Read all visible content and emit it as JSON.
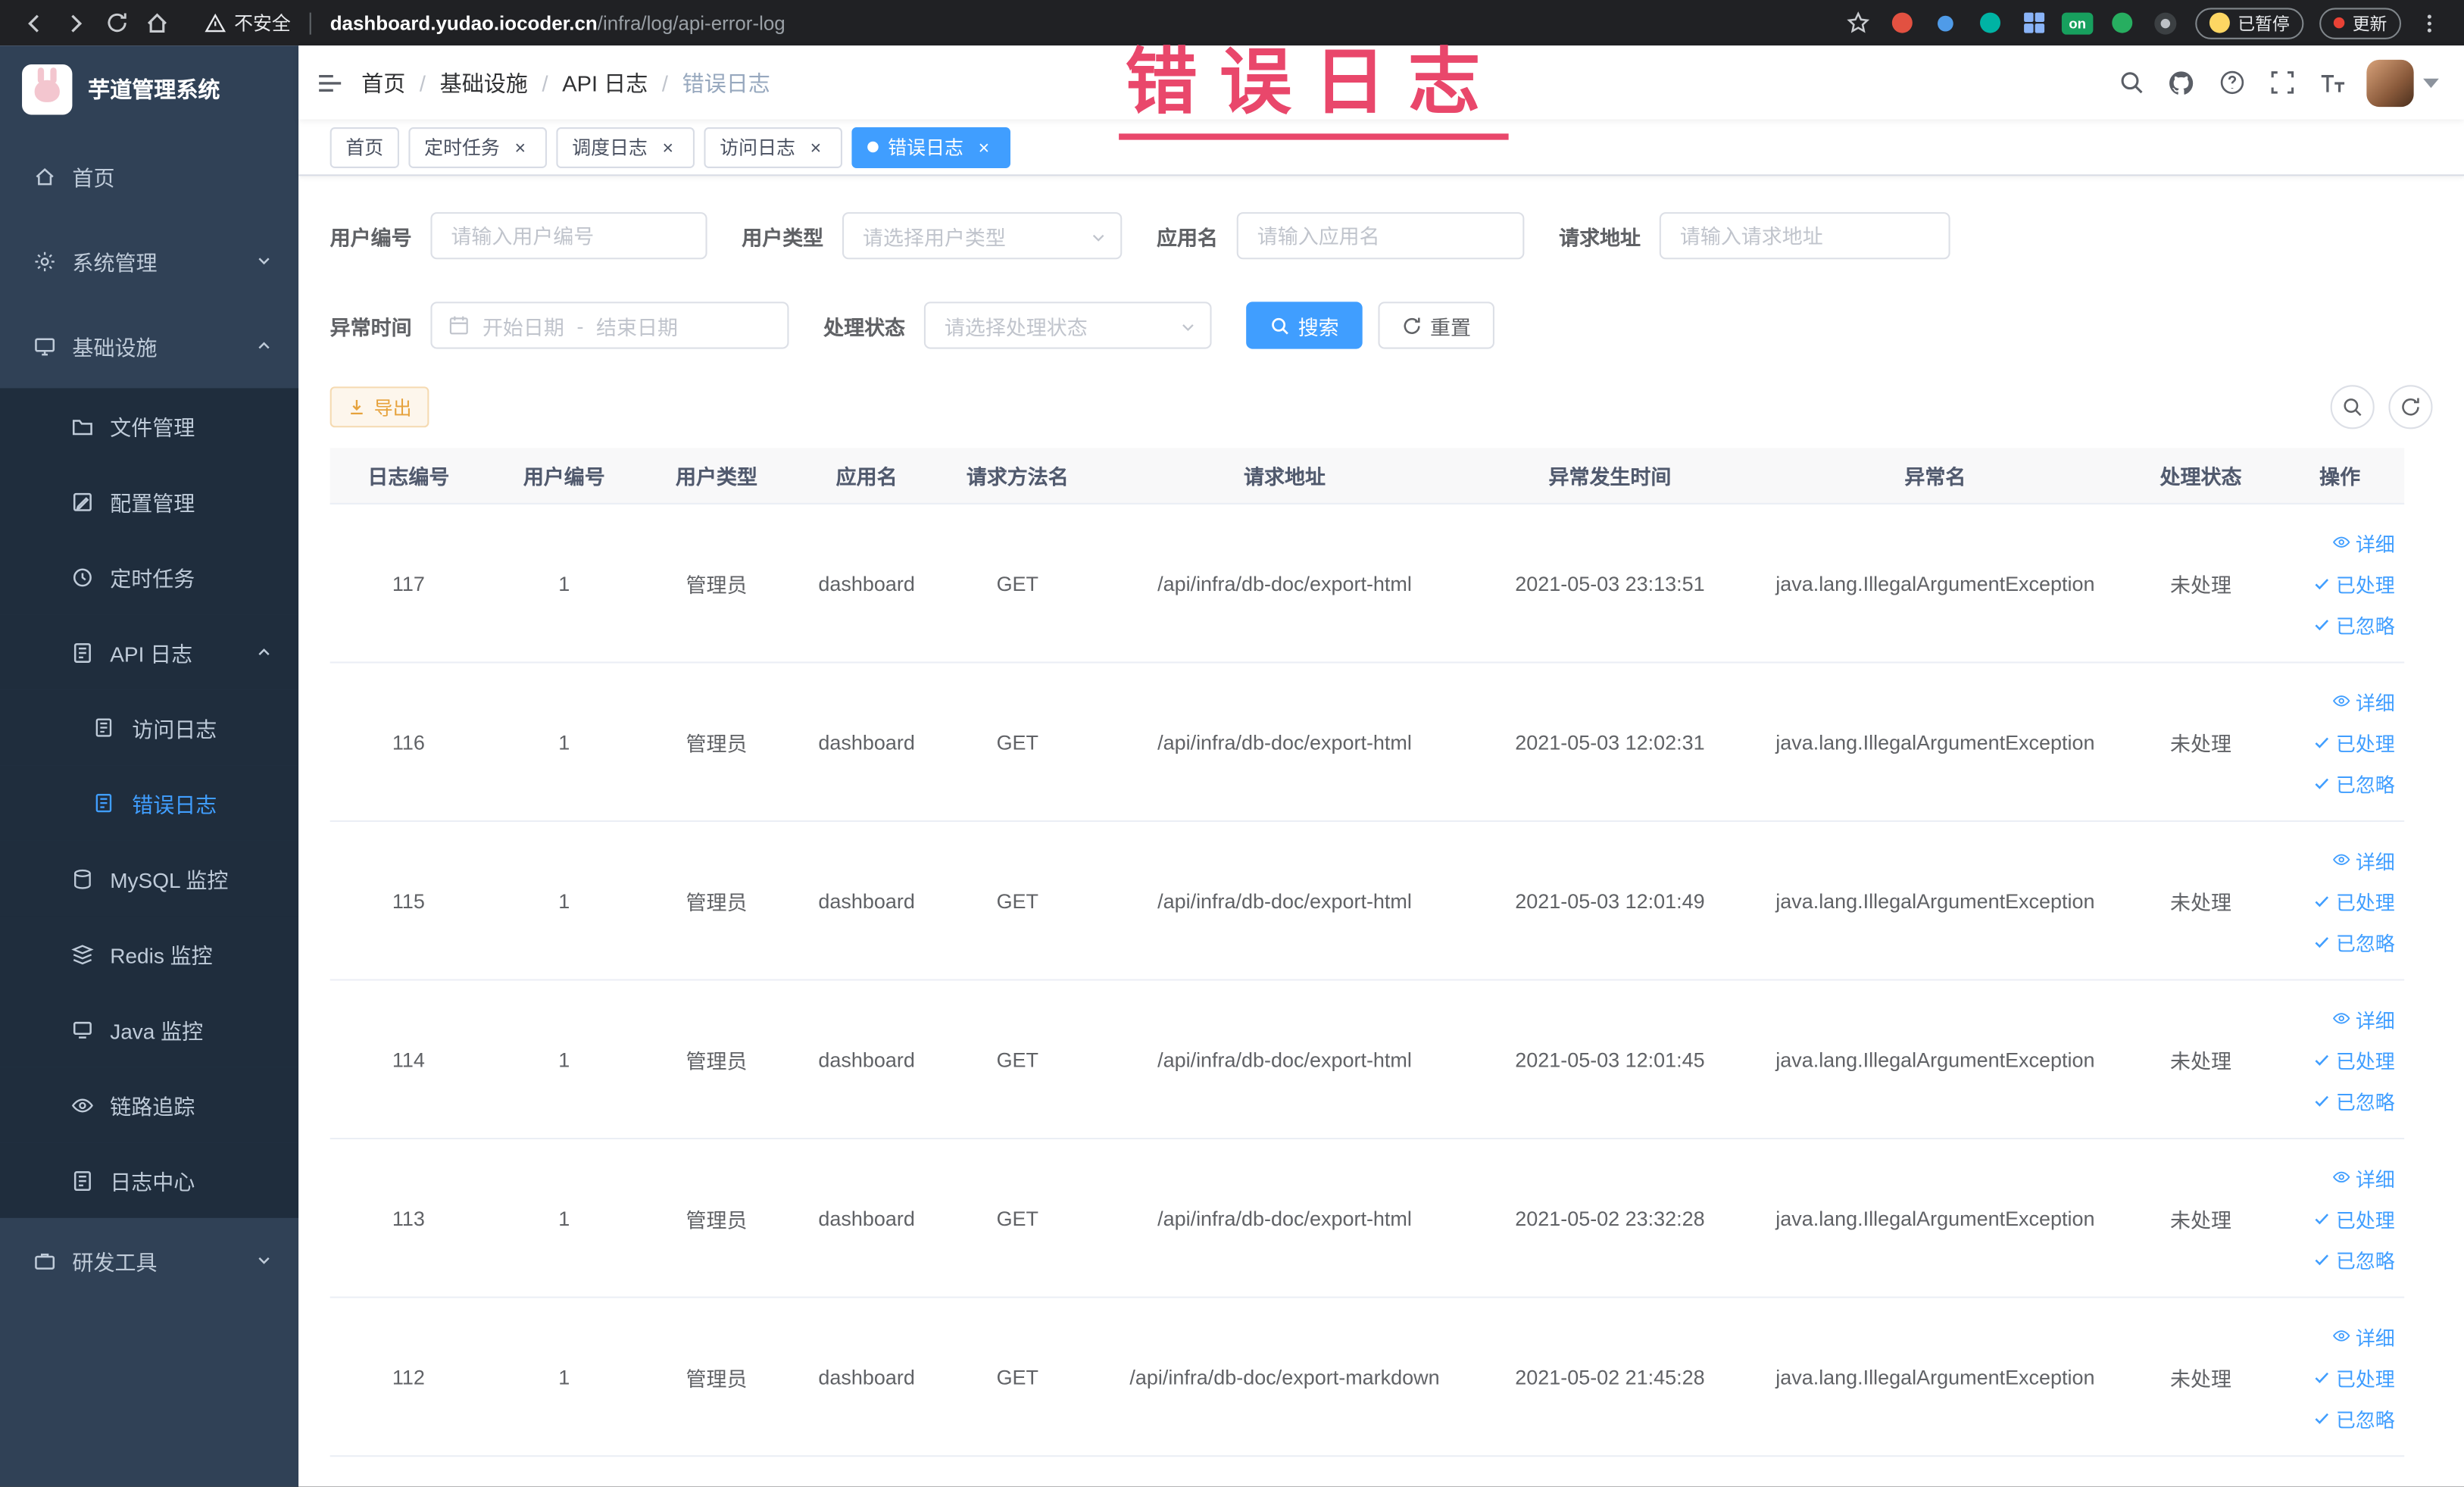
{
  "browser": {
    "security_label": "不安全",
    "url_host": "dashboard.yudao.iocoder.cn",
    "url_path": "/infra/log/api-error-log",
    "extension_on_badge": "on",
    "paused_badge": "已暂停",
    "update_button": "更新"
  },
  "sidebar": {
    "logo_title": "芋道管理系统",
    "items": [
      {
        "label": "首页"
      },
      {
        "label": "系统管理"
      },
      {
        "label": "基础设施"
      },
      {
        "label": "文件管理"
      },
      {
        "label": "配置管理"
      },
      {
        "label": "定时任务"
      },
      {
        "label": "API 日志"
      },
      {
        "label": "访问日志"
      },
      {
        "label": "错误日志"
      },
      {
        "label": "MySQL 监控"
      },
      {
        "label": "Redis 监控"
      },
      {
        "label": "Java 监控"
      },
      {
        "label": "链路追踪"
      },
      {
        "label": "日志中心"
      },
      {
        "label": "研发工具"
      }
    ]
  },
  "header": {
    "breadcrumb": [
      "首页",
      "基础设施",
      "API 日志",
      "错误日志"
    ]
  },
  "annotation": {
    "text": "错误日志",
    "color": "#e9476b"
  },
  "tabs": [
    {
      "label": "首页"
    },
    {
      "label": "定时任务"
    },
    {
      "label": "调度日志"
    },
    {
      "label": "访问日志"
    },
    {
      "label": "错误日志"
    }
  ],
  "filters": {
    "user_id": {
      "label": "用户编号",
      "placeholder": "请输入用户编号"
    },
    "user_type": {
      "label": "用户类型",
      "placeholder": "请选择用户类型"
    },
    "app_name": {
      "label": "应用名",
      "placeholder": "请输入应用名"
    },
    "request_url": {
      "label": "请求地址",
      "placeholder": "请输入请求地址"
    },
    "exception_time": {
      "label": "异常时间",
      "start_placeholder": "开始日期",
      "separator": "-",
      "end_placeholder": "结束日期"
    },
    "process_status": {
      "label": "处理状态",
      "placeholder": "请选择处理状态"
    },
    "search_button": "搜索",
    "reset_button": "重置"
  },
  "toolbar": {
    "export_button": "导出"
  },
  "table": {
    "columns": [
      "日志编号",
      "用户编号",
      "用户类型",
      "应用名",
      "请求方法名",
      "请求地址",
      "异常发生时间",
      "异常名",
      "处理状态",
      "操作"
    ],
    "actions": [
      "详细",
      "已处理",
      "已忽略"
    ],
    "rows": [
      {
        "log_id": "117",
        "user_id": "1",
        "user_type": "管理员",
        "app_name": "dashboard",
        "method": "GET",
        "url": "/api/infra/db-doc/export-html",
        "time": "2021-05-03 23:13:51",
        "exception": "java.lang.IllegalArgumentException",
        "status": "未处理"
      },
      {
        "log_id": "116",
        "user_id": "1",
        "user_type": "管理员",
        "app_name": "dashboard",
        "method": "GET",
        "url": "/api/infra/db-doc/export-html",
        "time": "2021-05-03 12:02:31",
        "exception": "java.lang.IllegalArgumentException",
        "status": "未处理"
      },
      {
        "log_id": "115",
        "user_id": "1",
        "user_type": "管理员",
        "app_name": "dashboard",
        "method": "GET",
        "url": "/api/infra/db-doc/export-html",
        "time": "2021-05-03 12:01:49",
        "exception": "java.lang.IllegalArgumentException",
        "status": "未处理"
      },
      {
        "log_id": "114",
        "user_id": "1",
        "user_type": "管理员",
        "app_name": "dashboard",
        "method": "GET",
        "url": "/api/infra/db-doc/export-html",
        "time": "2021-05-03 12:01:45",
        "exception": "java.lang.IllegalArgumentException",
        "status": "未处理"
      },
      {
        "log_id": "113",
        "user_id": "1",
        "user_type": "管理员",
        "app_name": "dashboard",
        "method": "GET",
        "url": "/api/infra/db-doc/export-html",
        "time": "2021-05-02 23:32:28",
        "exception": "java.lang.IllegalArgumentException",
        "status": "未处理"
      },
      {
        "log_id": "112",
        "user_id": "1",
        "user_type": "管理员",
        "app_name": "dashboard",
        "method": "GET",
        "url": "/api/infra/db-doc/export-markdown",
        "time": "2021-05-02 21:45:28",
        "exception": "java.lang.IllegalArgumentException",
        "status": "未处理"
      }
    ]
  },
  "colors": {
    "primary": "#409eff",
    "warning": "#e6a23c",
    "sidebar_bg": "#304156",
    "sidebar_sub_bg": "#1f2d3d"
  }
}
